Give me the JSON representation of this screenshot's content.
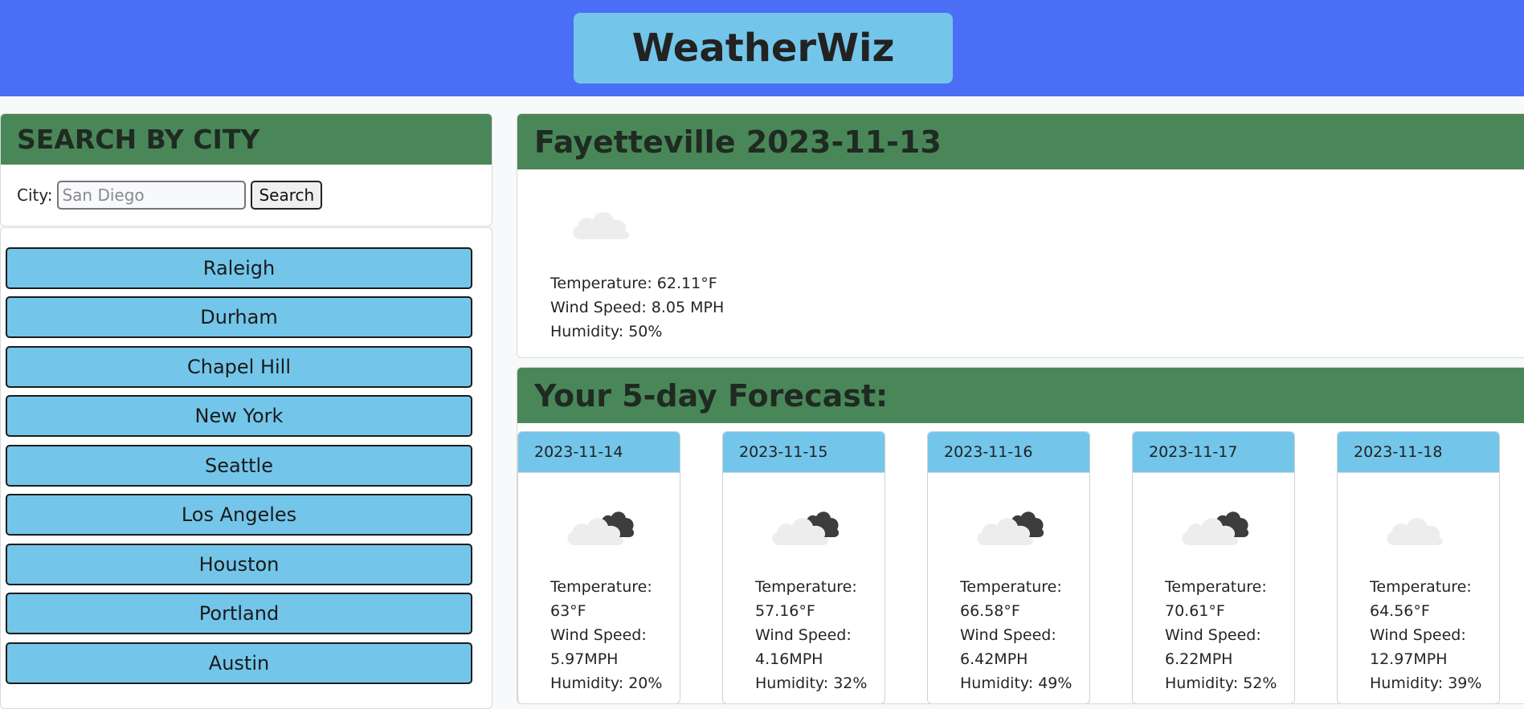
{
  "app": {
    "title": "WeatherWiz"
  },
  "search": {
    "heading": "SEARCH BY CITY",
    "label": "City:",
    "placeholder": "San Diego",
    "button": "Search"
  },
  "history": [
    "Raleigh",
    "Durham",
    "Chapel Hill",
    "New York",
    "Seattle",
    "Los Angeles",
    "Houston",
    "Portland",
    "Austin"
  ],
  "current": {
    "heading": "Fayetteville 2023-11-13",
    "icon": "cloud-icon",
    "temperature": "Temperature: 62.11°F",
    "wind": "Wind Speed: 8.05 MPH",
    "humidity": "Humidity: 50%"
  },
  "forecast": {
    "heading": "Your 5-day Forecast:",
    "days": [
      {
        "date": "2023-11-14",
        "icon": "broken-clouds-icon",
        "lines": [
          "Temperature: 63°F",
          "Wind Speed:",
          "5.97MPH",
          "Humidity: 20%"
        ]
      },
      {
        "date": "2023-11-15",
        "icon": "broken-clouds-icon",
        "lines": [
          "Temperature:",
          "57.16°F",
          "Wind Speed:",
          "4.16MPH",
          "Humidity: 32%"
        ]
      },
      {
        "date": "2023-11-16",
        "icon": "broken-clouds-icon",
        "lines": [
          "Temperature:",
          "66.58°F",
          "Wind Speed:",
          "6.42MPH",
          "Humidity: 49%"
        ]
      },
      {
        "date": "2023-11-17",
        "icon": "broken-clouds-icon",
        "lines": [
          "Temperature:",
          "70.61°F",
          "Wind Speed:",
          "6.22MPH",
          "Humidity: 52%"
        ]
      },
      {
        "date": "2023-11-18",
        "icon": "cloud-icon",
        "lines": [
          "Temperature:",
          "64.56°F",
          "Wind Speed:",
          "12.97MPH",
          "Humidity: 39%"
        ]
      }
    ]
  },
  "colors": {
    "header": "#4a6ef5",
    "accent": "#73c6ea",
    "panel_header": "#4a8758"
  }
}
